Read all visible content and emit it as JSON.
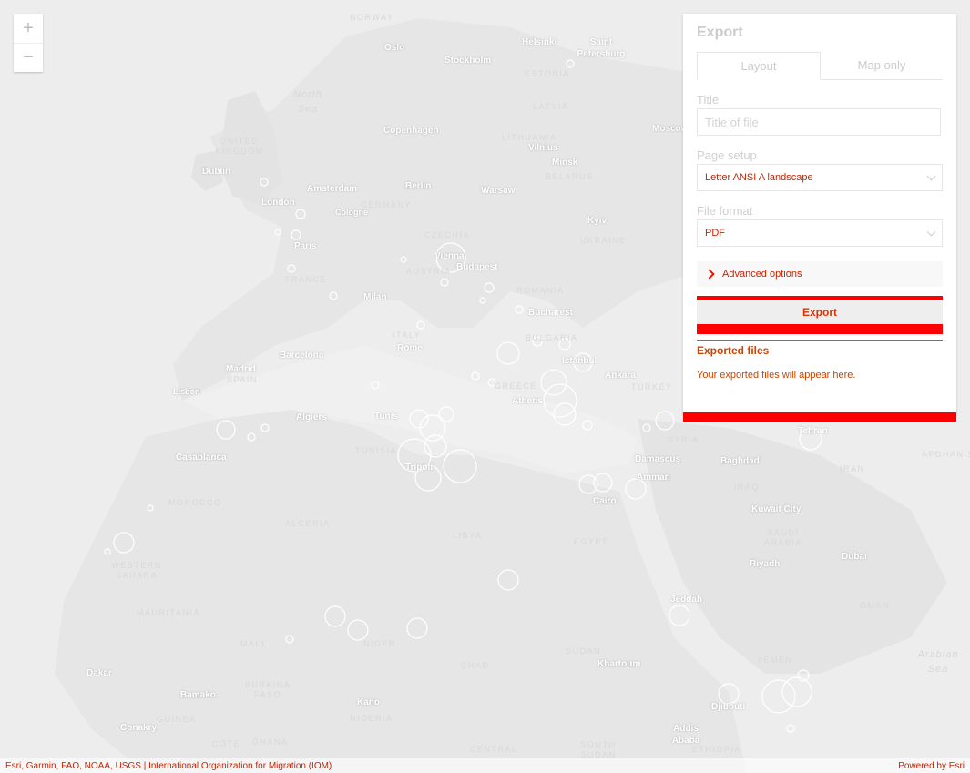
{
  "map": {
    "zoom_in_label": "+",
    "zoom_out_label": "−",
    "cities": [
      {
        "name": "Oslo"
      },
      {
        "name": "Stockholm"
      },
      {
        "name": "Helsinki"
      },
      {
        "name": "Saint Petersburg"
      },
      {
        "name": "Dublin"
      },
      {
        "name": "Copenhagen"
      },
      {
        "name": "Vilnius"
      },
      {
        "name": "Minsk"
      },
      {
        "name": "Moscow"
      },
      {
        "name": "London"
      },
      {
        "name": "Amsterdam"
      },
      {
        "name": "Berlin"
      },
      {
        "name": "Warsaw"
      },
      {
        "name": "Cologne"
      },
      {
        "name": "Kyiv"
      },
      {
        "name": "Paris"
      },
      {
        "name": "Vienna"
      },
      {
        "name": "Budapest"
      },
      {
        "name": "Milan"
      },
      {
        "name": "Bucharest"
      },
      {
        "name": "Barcelona"
      },
      {
        "name": "Rome"
      },
      {
        "name": "Istanbul"
      },
      {
        "name": "Madrid"
      },
      {
        "name": "Lisbon"
      },
      {
        "name": "Ankara"
      },
      {
        "name": "Athens"
      },
      {
        "name": "Algiers"
      },
      {
        "name": "Tunis"
      },
      {
        "name": "Tehran"
      },
      {
        "name": "Casablanca"
      },
      {
        "name": "Tripoli"
      },
      {
        "name": "Damascus"
      },
      {
        "name": "Baghdad"
      },
      {
        "name": "Amman"
      },
      {
        "name": "Cairo"
      },
      {
        "name": "Kuwait City"
      },
      {
        "name": "Riyadh"
      },
      {
        "name": "Dubai"
      },
      {
        "name": "Jeddah"
      },
      {
        "name": "Khartoum"
      },
      {
        "name": "Dakar"
      },
      {
        "name": "Bamako"
      },
      {
        "name": "Kano"
      },
      {
        "name": "Djibouti"
      },
      {
        "name": "Addis Ababa"
      },
      {
        "name": "Conakry"
      }
    ],
    "countries": [
      {
        "name": "NORWAY"
      },
      {
        "name": "ESTONIA"
      },
      {
        "name": "LATVIA"
      },
      {
        "name": "LITHUANIA"
      },
      {
        "name": "UNITED KINGDOM"
      },
      {
        "name": "BELARUS"
      },
      {
        "name": "GERMANY"
      },
      {
        "name": "CZECHIA"
      },
      {
        "name": "UKRAINE"
      },
      {
        "name": "FRANCE"
      },
      {
        "name": "AUSTRIA"
      },
      {
        "name": "ROMANIA"
      },
      {
        "name": "BULGARIA"
      },
      {
        "name": "ITALY"
      },
      {
        "name": "SPAIN"
      },
      {
        "name": "TURKEY"
      },
      {
        "name": "GREECE"
      },
      {
        "name": "SYRIA"
      },
      {
        "name": "TUNISIA"
      },
      {
        "name": "IRAQ"
      },
      {
        "name": "IRAN"
      },
      {
        "name": "AFGHANISTAN"
      },
      {
        "name": "MOROCCO"
      },
      {
        "name": "ALGERIA"
      },
      {
        "name": "LIBYA"
      },
      {
        "name": "EGYPT"
      },
      {
        "name": "WESTERN SAHARA"
      },
      {
        "name": "MAURITANIA"
      },
      {
        "name": "MALI"
      },
      {
        "name": "NIGER"
      },
      {
        "name": "CHAD"
      },
      {
        "name": "SUDAN"
      },
      {
        "name": "SAUDI ARABIA"
      },
      {
        "name": "OMAN"
      },
      {
        "name": "YEMEN"
      },
      {
        "name": "BURKINA FASO"
      },
      {
        "name": "NIGERIA"
      },
      {
        "name": "GUINEA"
      },
      {
        "name": "GHANA"
      },
      {
        "name": "COTE"
      },
      {
        "name": "CENTRAL"
      },
      {
        "name": "SOUTH SUDAN"
      },
      {
        "name": "ETHIOPIA"
      }
    ],
    "seas": [
      {
        "name": "North Sea"
      },
      {
        "name": "Arabian Sea"
      }
    ]
  },
  "export_panel": {
    "title": "Export",
    "tabs": [
      "Layout",
      "Map only"
    ],
    "title_label": "Title",
    "title_placeholder": "Title of file",
    "page_setup_label": "Page setup",
    "page_setup_value": "Letter ANSI A landscape",
    "file_format_label": "File format",
    "file_format_value": "PDF",
    "advanced_label": "Advanced options",
    "export_button": "Export",
    "exported_files_title": "Exported files",
    "exported_files_empty": "Your exported files will appear here."
  },
  "attribution": {
    "left": "Esri, Garmin, FAO, NOAA, USGS | International Organization for Migration (IOM)",
    "right": "Powered by Esri"
  },
  "colors": {
    "map_bg": "#ececec",
    "land": "#e4e4e4",
    "water": "#efefef",
    "alert_red": "#ff0000"
  }
}
